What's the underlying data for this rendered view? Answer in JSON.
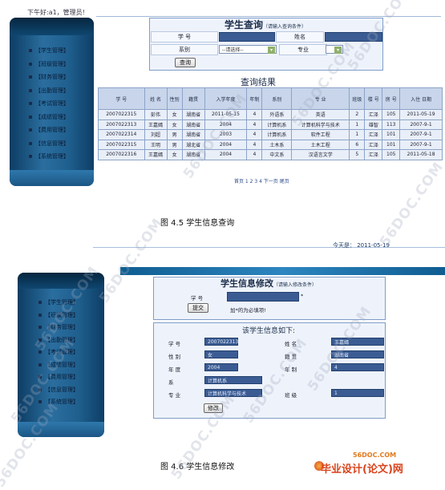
{
  "fig1": {
    "greeting": "下午好:a1，管理员!",
    "menu": [
      "【学生管理】",
      "【班级管理】",
      "【财务管理】",
      "【出勤管理】",
      "【考试管理】",
      "【成绩管理】",
      "【费用管理】",
      "【信息管理】",
      "【系统管理】"
    ],
    "query": {
      "title": "学生查询",
      "subtitle": "（请输入查询条件）",
      "label_xuehao": "学 号",
      "label_name": "姓名",
      "label_dept": "系别",
      "dept_selected": "--请选择--",
      "label_major": "专业",
      "button": "查询"
    },
    "results_title": "查询结果",
    "table": {
      "headers": [
        "学 号",
        "姓 名",
        "性别",
        "籍贯",
        "入学年度",
        "年制",
        "系别",
        "专 业",
        "班级",
        "楼 号",
        "房 号",
        "入住 日期"
      ],
      "rows": [
        [
          "2007022315",
          "彭伟",
          "女",
          "湖南省",
          "2011-05-15",
          "4",
          "外语系",
          "英语",
          "2",
          "汇泽",
          "105",
          "2011-05-19"
        ],
        [
          "2007022313",
          "王嘉嫣",
          "女",
          "湖南省",
          "2004",
          "4",
          "计算机系",
          "计算机科学与技术",
          "1",
          "雄智",
          "113",
          "2007-9-1"
        ],
        [
          "2007022314",
          "刘超",
          "男",
          "湖南省",
          "2003",
          "4",
          "计算机系",
          "软件工程",
          "1",
          "汇泽",
          "101",
          "2007-9-1"
        ],
        [
          "2007022315",
          "王明",
          "男",
          "湖北省",
          "2004",
          "4",
          "土木系",
          "土木工程",
          "6",
          "汇泽",
          "101",
          "2007-9-1"
        ],
        [
          "2007022316",
          "王嘉嫣",
          "女",
          "湖南省",
          "2004",
          "4",
          "中文系",
          "汉语言文学",
          "5",
          "汇泽",
          "105",
          "2011-05-18"
        ]
      ]
    },
    "pager": "首页 1 2 3 4 下一页 尾页",
    "caption": "图 4.5  学生信息查询"
  },
  "fig2": {
    "date": "今天是：  2011-05-19",
    "menu": [
      "【学生管理】",
      "【班级管理】",
      "【财务管理】",
      "【出勤管理】",
      "【考试管理】",
      "【成绩管理】",
      "【费用管理】",
      "【信息管理】",
      "【系统管理】"
    ],
    "modify": {
      "title": "学生信息修改",
      "subtitle": "（请输入修改条件）",
      "label_xuehao": "学 号",
      "star": "*",
      "button": "提交",
      "note": "加*的为必填项!"
    },
    "info": {
      "title": "该学生信息如下:",
      "rows": [
        {
          "l1": "学 号",
          "v1": "2007022313",
          "l2": "姓 名",
          "v2": "王嘉嫣"
        },
        {
          "l1": "性 别",
          "v1": "女",
          "l2": "籍 贯",
          "v2": "湖南省"
        },
        {
          "l1": "年 度",
          "v1": "2004",
          "l2": "年 制",
          "v2": "4"
        },
        {
          "l1": "系",
          "v1": "计算机系",
          "l2": "",
          "v2": ""
        },
        {
          "l1": "专 业",
          "v1": "计算机科学与技术",
          "l2": "班 级",
          "v2": "1"
        }
      ],
      "button": "修改"
    },
    "caption": "图 4.6  学生信息修改"
  },
  "watermark": "56DOC.COM",
  "logo": {
    "small": "56DOC.COM",
    "big": "毕业设计(论文)网"
  }
}
